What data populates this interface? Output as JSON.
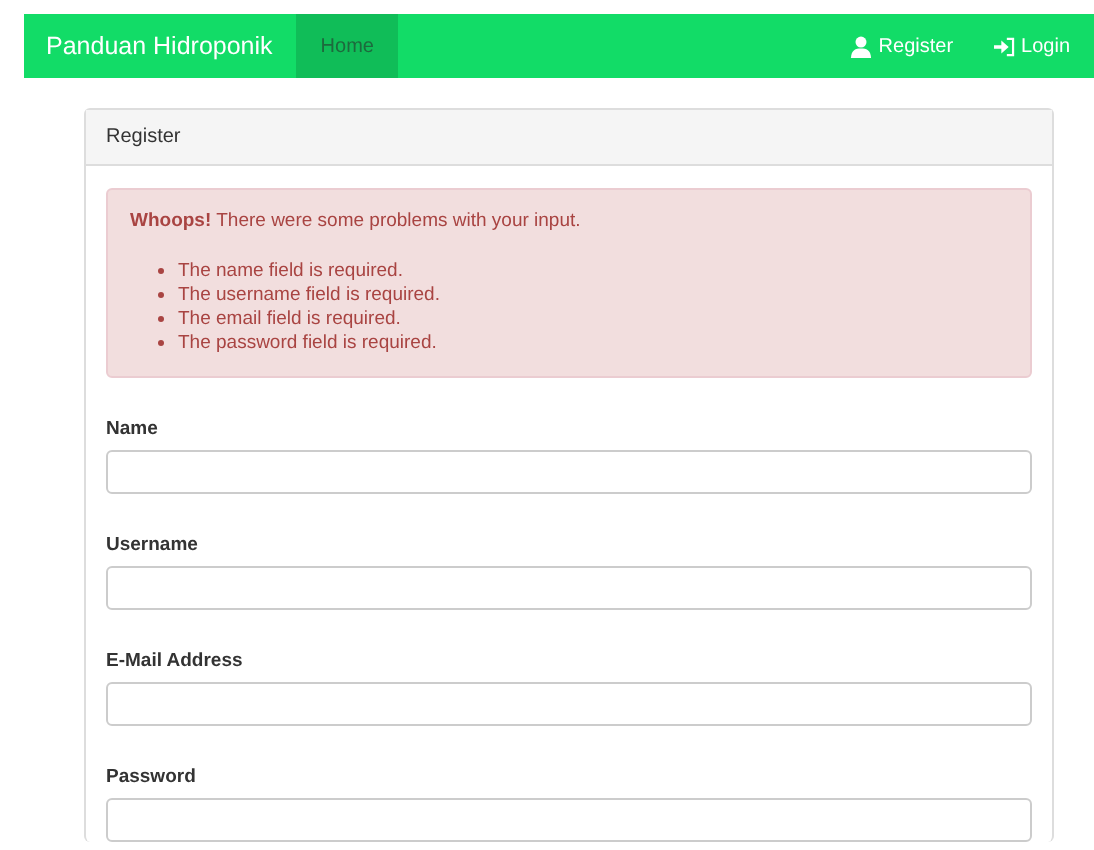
{
  "navbar": {
    "brand": "Panduan Hidroponik",
    "nav_items": [
      {
        "label": "Home",
        "selected": true
      }
    ],
    "right_items": [
      {
        "label": "Register"
      },
      {
        "label": "Login"
      }
    ]
  },
  "panel": {
    "title": "Register",
    "alert": {
      "lead": "**Whoops!** There were some problems with your input.",
      "errors": [
        "The name field is required.",
        "The username field is required.",
        "The email field is required.",
        "The password field is required."
      ]
    },
    "fields": [
      {
        "label": "Name"
      },
      {
        "label": "Username"
      },
      {
        "label": "E-Mail Address"
      },
      {
        "label": "Password"
      }
    ]
  }
}
